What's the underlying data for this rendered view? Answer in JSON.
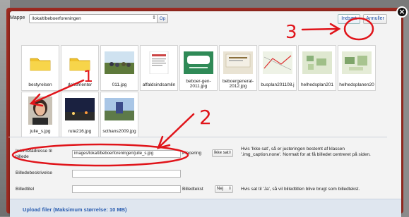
{
  "dialog": {
    "folder_label": "Mappe",
    "folder_value": "/lokalt/beboerforeningen",
    "ok_label": "Op",
    "insert_label": "Indsæt",
    "cancel_label": "Annuller"
  },
  "gallery": {
    "items": [
      {
        "caption": "bestyrelsen",
        "kind": "folder"
      },
      {
        "caption": "dokumenter",
        "kind": "folder"
      },
      {
        "caption": "011.jpg",
        "kind": "photo"
      },
      {
        "caption": "affaldsindsamlin",
        "kind": "doc"
      },
      {
        "caption": "beboer-gen-2011.jpg",
        "kind": "green"
      },
      {
        "caption": "beboergeneral-2012.jpg",
        "kind": "photo"
      },
      {
        "caption": "busplan201108.j",
        "kind": "map"
      },
      {
        "caption": "helhedsplan201",
        "kind": "map"
      },
      {
        "caption": "helhedsplanen20",
        "kind": "map"
      },
      {
        "caption": "julie_s.jpg",
        "kind": "portrait"
      },
      {
        "caption": "rute216.jpg",
        "kind": "night"
      },
      {
        "caption": "scthans2009.jpg",
        "kind": "photo"
      }
    ]
  },
  "form": {
    "url_label": "Internetadresse til billede",
    "url_value": "images/lokalt/beboerforeningen/julie_s.jpg",
    "placement_label": "Placering",
    "placement_value": "Ikke sat",
    "placement_help": "Hvis 'Ikke sat', så er justeringen bestemt af klassen '.img_caption.none'. Normalt for at få billedet centreret på siden.",
    "description_label": "Billedebeskrivelse",
    "title_label": "Billedtitel",
    "caption_label": "Billedtekst",
    "caption_value": "Nej",
    "caption_help": "Hvis sat til 'Ja', så vil billedtitlen blive brugt som billedtekst."
  },
  "upload": {
    "title": "Upload filer (Maksimum størrelse: 10 MB)"
  },
  "annotations": {
    "step1": "1",
    "step2": "2",
    "step3": "3",
    "color": "#e0141a"
  }
}
